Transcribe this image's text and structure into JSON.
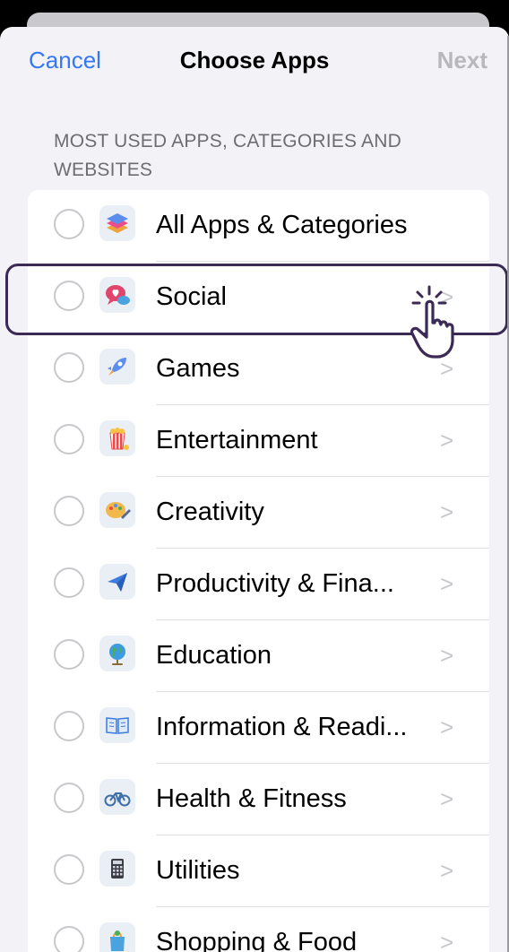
{
  "nav": {
    "cancel_label": "Cancel",
    "title": "Choose Apps",
    "next_label": "Next"
  },
  "section_header": "MOST USED APPS, CATEGORIES AND WEBSITES",
  "items": [
    {
      "label": "All Apps & Categories",
      "icon": "stack-layers-icon",
      "chevron": ""
    },
    {
      "label": "Social",
      "icon": "chat-heart-icon",
      "chevron": ">"
    },
    {
      "label": "Games",
      "icon": "rocket-icon",
      "chevron": ">"
    },
    {
      "label": "Entertainment",
      "icon": "popcorn-icon",
      "chevron": ">"
    },
    {
      "label": "Creativity",
      "icon": "palette-icon",
      "chevron": ">"
    },
    {
      "label": "Productivity & Fina...",
      "icon": "paper-plane-icon",
      "chevron": ">"
    },
    {
      "label": "Education",
      "icon": "globe-icon",
      "chevron": ">"
    },
    {
      "label": "Information & Readi...",
      "icon": "book-icon",
      "chevron": ">"
    },
    {
      "label": "Health & Fitness",
      "icon": "bicycle-icon",
      "chevron": ">"
    },
    {
      "label": "Utilities",
      "icon": "calculator-icon",
      "chevron": ">"
    },
    {
      "label": "Shopping & Food",
      "icon": "shopping-bag-icon",
      "chevron": ">"
    }
  ],
  "colors": {
    "accent": "#3478f6",
    "disabled": "#b7b7bc",
    "highlight_border": "#3a2a55"
  }
}
